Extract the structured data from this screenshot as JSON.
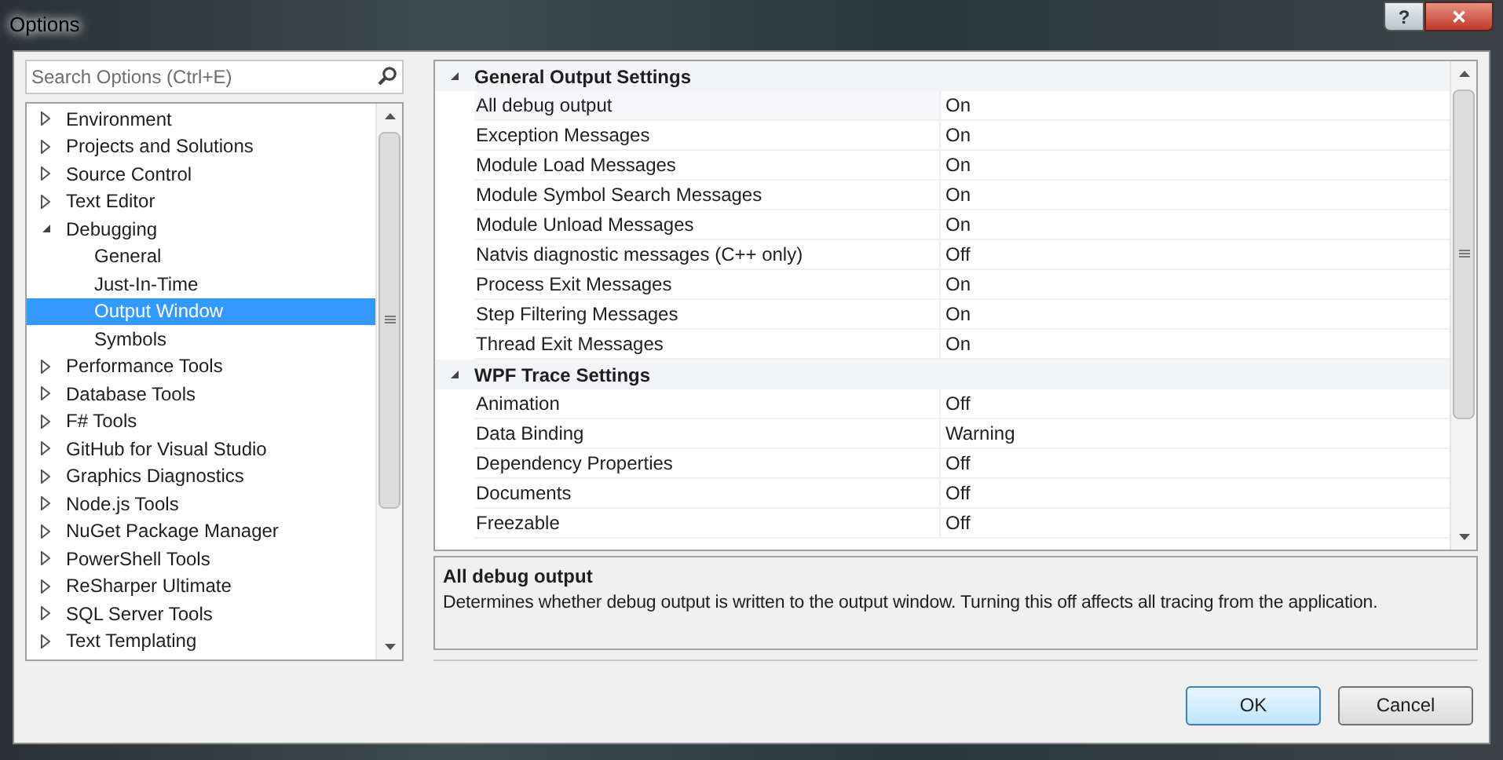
{
  "window": {
    "title": "Options",
    "help": "?",
    "close": "✕"
  },
  "search": {
    "placeholder": "Search Options (Ctrl+E)"
  },
  "tree": [
    {
      "label": "Environment",
      "expanded": false,
      "selected": false
    },
    {
      "label": "Projects and Solutions",
      "expanded": false,
      "selected": false
    },
    {
      "label": "Source Control",
      "expanded": false,
      "selected": false
    },
    {
      "label": "Text Editor",
      "expanded": false,
      "selected": false
    },
    {
      "label": "Debugging",
      "expanded": true,
      "selected": false,
      "children": [
        {
          "label": "General",
          "selected": false
        },
        {
          "label": "Just-In-Time",
          "selected": false
        },
        {
          "label": "Output Window",
          "selected": true
        },
        {
          "label": "Symbols",
          "selected": false
        }
      ]
    },
    {
      "label": "Performance Tools",
      "expanded": false,
      "selected": false
    },
    {
      "label": "Database Tools",
      "expanded": false,
      "selected": false
    },
    {
      "label": "F# Tools",
      "expanded": false,
      "selected": false
    },
    {
      "label": "GitHub for Visual Studio",
      "expanded": false,
      "selected": false
    },
    {
      "label": "Graphics Diagnostics",
      "expanded": false,
      "selected": false
    },
    {
      "label": "Node.js Tools",
      "expanded": false,
      "selected": false
    },
    {
      "label": "NuGet Package Manager",
      "expanded": false,
      "selected": false
    },
    {
      "label": "PowerShell Tools",
      "expanded": false,
      "selected": false
    },
    {
      "label": "ReSharper Ultimate",
      "expanded": false,
      "selected": false
    },
    {
      "label": "SQL Server Tools",
      "expanded": false,
      "selected": false
    },
    {
      "label": "Text Templating",
      "expanded": false,
      "selected": false
    }
  ],
  "property_grid": [
    {
      "category": "General Output Settings",
      "expanded": true,
      "properties": [
        {
          "name": "All debug output",
          "value": "On",
          "selected": true
        },
        {
          "name": "Exception Messages",
          "value": "On",
          "selected": false
        },
        {
          "name": "Module Load Messages",
          "value": "On",
          "selected": false
        },
        {
          "name": "Module Symbol Search Messages",
          "value": "On",
          "selected": false
        },
        {
          "name": "Module Unload Messages",
          "value": "On",
          "selected": false
        },
        {
          "name": "Natvis diagnostic messages (C++ only)",
          "value": "Off",
          "selected": false
        },
        {
          "name": "Process Exit Messages",
          "value": "On",
          "selected": false
        },
        {
          "name": "Step Filtering Messages",
          "value": "On",
          "selected": false
        },
        {
          "name": "Thread Exit Messages",
          "value": "On",
          "selected": false
        }
      ]
    },
    {
      "category": "WPF Trace Settings",
      "expanded": true,
      "properties": [
        {
          "name": "Animation",
          "value": "Off",
          "selected": false
        },
        {
          "name": "Data Binding",
          "value": "Warning",
          "selected": false
        },
        {
          "name": "Dependency Properties",
          "value": "Off",
          "selected": false
        },
        {
          "name": "Documents",
          "value": "Off",
          "selected": false
        },
        {
          "name": "Freezable",
          "value": "Off",
          "selected": false
        }
      ]
    }
  ],
  "description": {
    "title": "All debug output",
    "text": "Determines whether debug output is written to the output window. Turning this off affects all tracing from the application."
  },
  "buttons": [
    {
      "label": "OK",
      "default": true
    },
    {
      "label": "Cancel",
      "default": false
    }
  ]
}
